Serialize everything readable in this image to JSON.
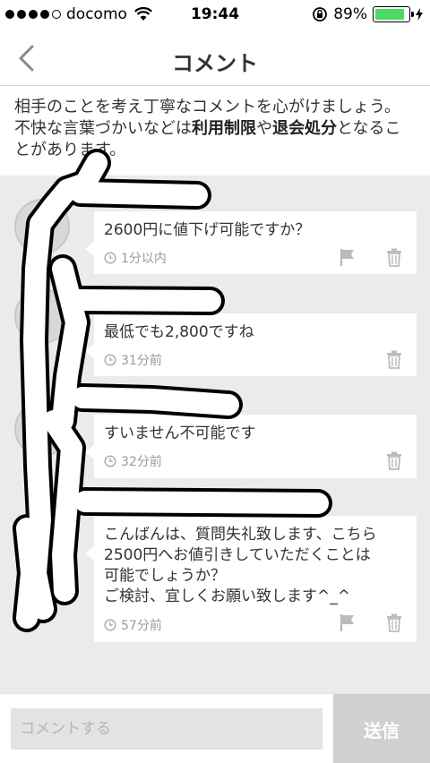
{
  "status_bar": {
    "carrier": "docomo",
    "time": "19:44",
    "battery": "89%",
    "battery_level": 0.89
  },
  "nav": {
    "title": "コメント"
  },
  "notice": {
    "text_1": "相手のことを考え丁寧なコメントを心がけましょう。不快な言葉づかいなどは",
    "bold_1": "利用制限",
    "text_2": "や",
    "bold_2": "退会処分",
    "text_3": "となることがあります。"
  },
  "comments": [
    {
      "text": "2600円に値下げ可能ですか？",
      "time": "1分以内",
      "show_flag": true
    },
    {
      "text": "最低でも2,800ですね",
      "time": "31分前",
      "show_flag": false
    },
    {
      "text": "すいません不可能です",
      "time": "32分前",
      "show_flag": false
    },
    {
      "text": "こんばんは、質問失礼致します、こちら\n2500円へお値引きしていただくことは\n可能でしょうか？\nご検討、宜しくお願い致します^_^",
      "time": "57分前",
      "show_flag": true
    }
  ],
  "input": {
    "placeholder": "コメントする"
  },
  "send": {
    "label": "送信"
  },
  "colors": {
    "background": "#ebebeb",
    "battery_green": "#4cd964",
    "send_disabled": "#d0d0d0"
  }
}
